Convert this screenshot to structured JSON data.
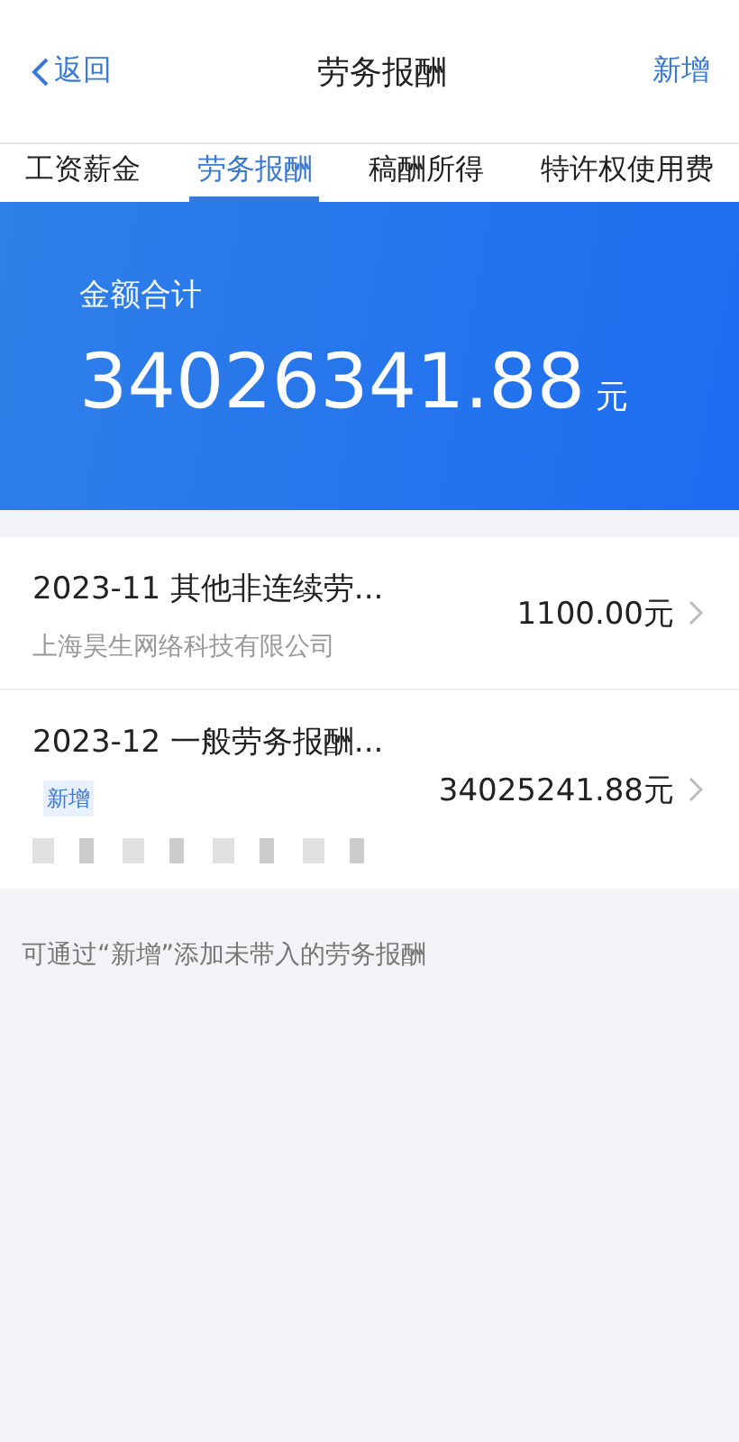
{
  "nav": {
    "back": "返回",
    "title": "劳务报酬",
    "action": "新增"
  },
  "tabs": [
    {
      "label": "工资薪金",
      "selected": false
    },
    {
      "label": "劳务报酬",
      "selected": true
    },
    {
      "label": "稿酬所得",
      "selected": false
    },
    {
      "label": "特许权使用费",
      "selected": false
    }
  ],
  "summary": {
    "label": "金额合计",
    "amount": "34026341.88",
    "unit": "元"
  },
  "records": [
    {
      "title": "2023-11 其他非连续劳...",
      "subtitle": "上海昊生网络科技有限公司",
      "amount": "1100.00元"
    },
    {
      "title": "2023-12 一般劳务报酬...",
      "badge": "新增",
      "amount": "34025241.88元",
      "subtitle_blurred": true
    }
  ],
  "hint": "可通过“新增”添加未带入的劳务报酬"
}
